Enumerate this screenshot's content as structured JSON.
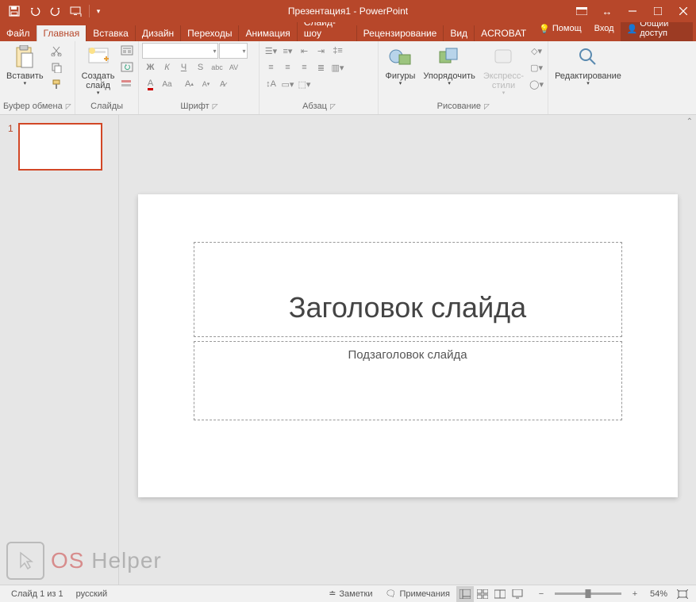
{
  "title": "Презентация1 - PowerPoint",
  "tabs": {
    "file": "Файл",
    "home": "Главная",
    "insert": "Вставка",
    "design": "Дизайн",
    "transitions": "Переходы",
    "animations": "Анимация",
    "slideshow": "Слайд-шоу",
    "review": "Рецензирование",
    "view": "Вид",
    "acrobat": "ACROBAT"
  },
  "help": "Помощ",
  "signin": "Вход",
  "share": "Общий доступ",
  "ribbon": {
    "clipboard": {
      "paste": "Вставить",
      "title": "Буфер обмена"
    },
    "slides": {
      "new": "Создать\nслайд",
      "title": "Слайды"
    },
    "font": {
      "title": "Шрифт",
      "bold": "Ж",
      "italic": "К",
      "underline": "Ч",
      "strike": "S",
      "shadow": "abc",
      "spacing": "AV",
      "clear": "A",
      "caps": "Aa"
    },
    "paragraph": {
      "title": "Абзац"
    },
    "drawing": {
      "shapes": "Фигуры",
      "arrange": "Упорядочить",
      "styles": "Экспресс-\nстили",
      "title": "Рисование"
    },
    "editing": {
      "label": "Редактирование"
    }
  },
  "slide": {
    "num": "1",
    "title": "Заголовок слайда",
    "subtitle": "Подзаголовок слайда"
  },
  "status": {
    "slide": "Слайд 1 из 1",
    "lang": "русский",
    "notes": "Заметки",
    "comments": "Примечания",
    "zoom": "54%"
  },
  "watermark": {
    "os": "OS",
    "helper": " Helper"
  }
}
